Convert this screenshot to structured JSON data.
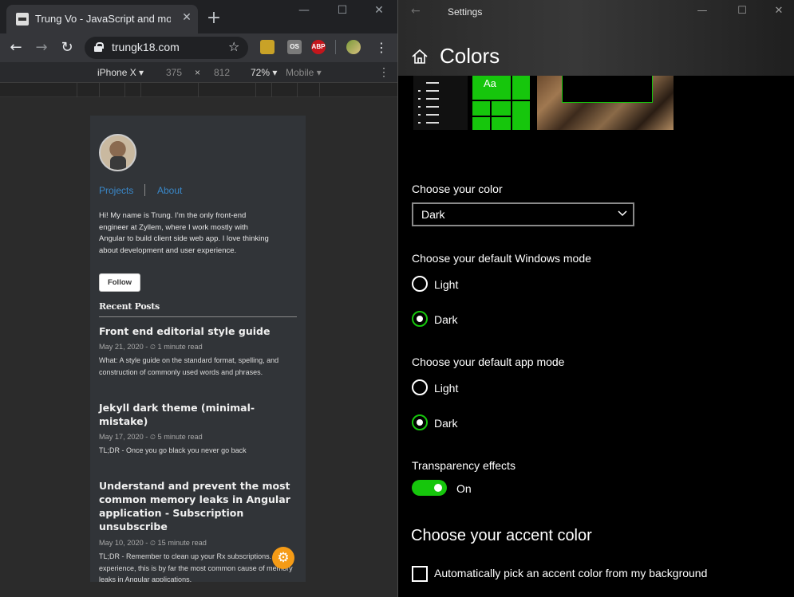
{
  "browser": {
    "tab_title": "Trung Vo - JavaScript and more",
    "url": "trungk18.com",
    "extensions": [
      {
        "name": "zoom-extension",
        "label": ""
      },
      {
        "name": "os-extension",
        "label": "OS"
      },
      {
        "name": "adblock-plus",
        "label": "ABP"
      },
      {
        "name": "profile",
        "label": ""
      }
    ],
    "devtools": {
      "device": "iPhone X",
      "width": "375",
      "times": "×",
      "height": "812",
      "zoom": "72%",
      "throttle": "Mobile"
    }
  },
  "blog": {
    "nav": {
      "projects": "Projects",
      "about": "About"
    },
    "bio": "Hi! My name is Trung. I’m the only front-end engineer at Zyllem, where I work mostly with Angular to build client side web app. I love thinking about development and user experience.",
    "follow": "Follow",
    "recent_heading": "Recent Posts",
    "posts": [
      {
        "title": "Front end editorial style guide",
        "meta": "May 21, 2020 - ⏲ 1 minute read",
        "excerpt": "What: A style guide on the standard format, spelling, and construction of commonly used words and phrases."
      },
      {
        "title": "Jekyll dark theme (minimal-mistake)",
        "meta": "May 17, 2020 - ⏲ 5 minute read",
        "excerpt": "TL;DR - Once you go black you never go back"
      },
      {
        "title": "Understand and prevent the most common memory leaks in Angular application - Subscription unsubscribe",
        "meta": "May 10, 2020 - ⏲ 15 minute read",
        "excerpt": "TL;DR - Remember to clean up your Rx subscriptions. In my experience, this is by far the most common cause of memory leaks in Angular applications."
      }
    ]
  },
  "settings": {
    "window_title": "Settings",
    "page_title": "Colors",
    "preview_tile_text": "Aa",
    "choose_color": {
      "label": "Choose your color",
      "value": "Dark"
    },
    "windows_mode": {
      "label": "Choose your default Windows mode",
      "options": [
        {
          "label": "Light",
          "selected": false
        },
        {
          "label": "Dark",
          "selected": true
        }
      ]
    },
    "app_mode": {
      "label": "Choose your default app mode",
      "options": [
        {
          "label": "Light",
          "selected": false
        },
        {
          "label": "Dark",
          "selected": true
        }
      ]
    },
    "transparency": {
      "label": "Transparency effects",
      "state": "On"
    },
    "accent_heading": "Choose your accent color",
    "auto_accent": {
      "label": "Automatically pick an accent color from my background",
      "checked": false
    },
    "colors": {
      "accent": "#16c60c",
      "background": "#000000"
    }
  }
}
